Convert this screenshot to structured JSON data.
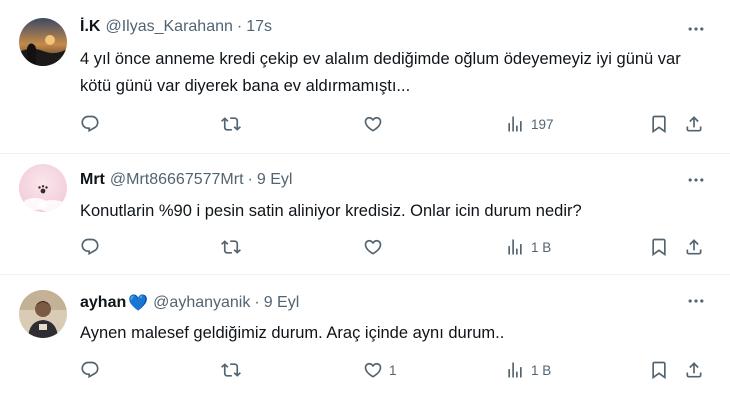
{
  "tweets": [
    {
      "name": "İ.K",
      "handle": "@Ilyas_Karahann",
      "separator": "·",
      "time": "17s",
      "text": "4 yıl önce anneme kredi çekip ev alalım dediğimde oğlum ödeyemeyiz iyi günü var kötü günü var diyerek bana ev aldırmamıştı...",
      "reply_count": "",
      "retweet_count": "",
      "like_count": "",
      "view_count": "197"
    },
    {
      "name": "Mrt",
      "handle": "@Mrt86667577Mrt",
      "separator": "·",
      "time": "9 Eyl",
      "text": "Konutlarin %90 i pesin satin aliniyor kredisiz. Onlar icin durum nedir?",
      "reply_count": "",
      "retweet_count": "",
      "like_count": "",
      "view_count": "1 B"
    },
    {
      "name": "ayhan",
      "name_emoji": "💙",
      "handle": "@ayhanyanik",
      "separator": "·",
      "time": "9 Eyl",
      "text": "Aynen malesef geldiğimiz durum. Araç içinde aynı durum..",
      "reply_count": "",
      "retweet_count": "",
      "like_count": "1",
      "view_count": "1 B"
    }
  ],
  "icons": {
    "reply": "reply-icon",
    "retweet": "retweet-icon",
    "like": "like-icon",
    "views": "views-icon",
    "bookmark": "bookmark-icon",
    "share": "share-icon",
    "more": "more-icon"
  },
  "colors": {
    "text": "#0f1419",
    "secondary": "#536471",
    "divider": "#eff3f4",
    "accent": "#1d9bf0"
  }
}
